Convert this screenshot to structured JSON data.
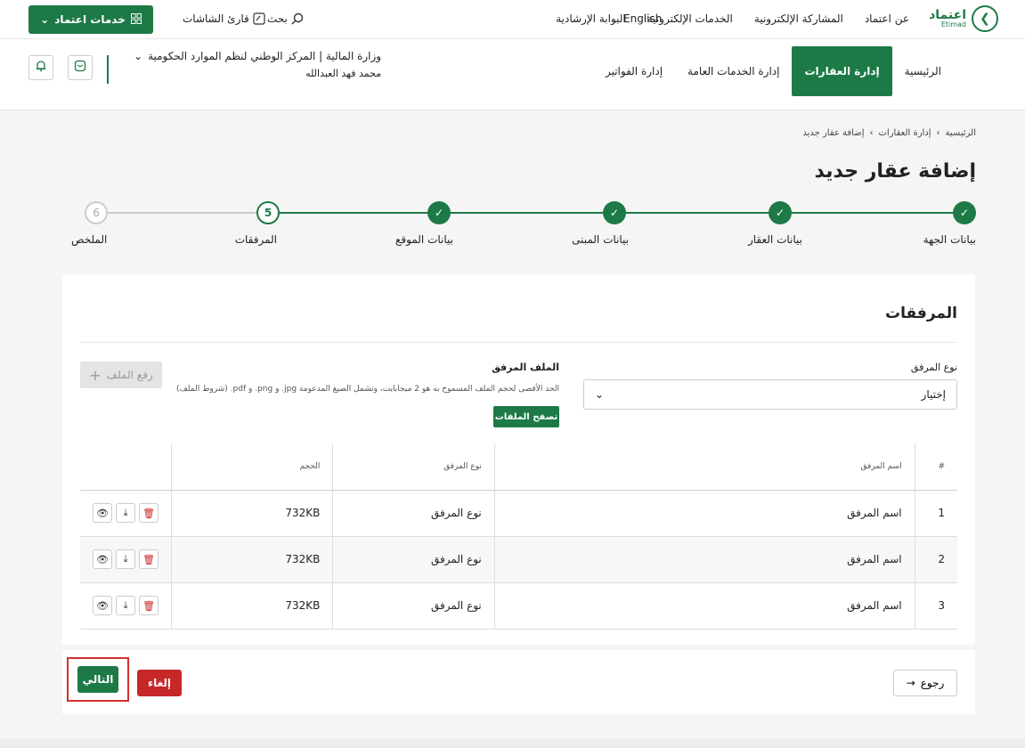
{
  "header": {
    "logo": {
      "ar": "اعتماد",
      "en": "Etimad"
    },
    "links": [
      "عن اعتماد",
      "المشاركة الإلكترونية",
      "الخدمات الإلكترونية",
      "البوابة الإرشادية"
    ],
    "language": "English",
    "search_label": "بحث",
    "reader_label": "قارئ الشاشات",
    "services_button": "خدمات اعتماد"
  },
  "nav": {
    "tabs": [
      {
        "label": "الرئيسية",
        "active": false
      },
      {
        "label": "إدارة العقارات",
        "active": true
      },
      {
        "label": "إدارة الخدمات العامة",
        "active": false
      },
      {
        "label": "إدارة الفواتير",
        "active": false
      }
    ],
    "org_name": "وزارة المالية | المركز الوطني لنظم الموارد الحكومية",
    "user_name": "محمد فهد العبدالله"
  },
  "breadcrumb": [
    "الرئيسية",
    "إدارة العقارات",
    "إضافة عقار جديد"
  ],
  "page_title": "إضافة عقار جديد",
  "stepper": {
    "steps": [
      {
        "label": "بيانات الجهة",
        "state": "done",
        "number": "1"
      },
      {
        "label": "بيانات العقار",
        "state": "done",
        "number": "2"
      },
      {
        "label": "بيانات المبنى",
        "state": "done",
        "number": "3"
      },
      {
        "label": "بيانات الموقع",
        "state": "done",
        "number": "4"
      },
      {
        "label": "المرفقات",
        "state": "current",
        "number": "5"
      },
      {
        "label": "الملخص",
        "state": "future",
        "number": "6"
      }
    ]
  },
  "attachments": {
    "section_title": "المرفقات",
    "type_label": "نوع المرفق",
    "type_value": "إختيار",
    "file_label": "الملف المرفق",
    "file_hint": "الحد الأقصى لحجم الملف المسموح به هو 2 ميجابايت، وتشمل الصيغ المدعومة jpg. و png. و pdf. (شروط الملف)",
    "browse_button": "تصفح الملفات",
    "upload_button": "رفع الملف",
    "table": {
      "headers": [
        "#",
        "اسم المرفق",
        "نوع المرفق",
        "الحجم",
        ""
      ],
      "rows": [
        {
          "index": "1",
          "name": "اسم المرفق",
          "type": "نوع المرفق",
          "size": "732KB"
        },
        {
          "index": "2",
          "name": "اسم المرفق",
          "type": "نوع المرفق",
          "size": "732KB"
        },
        {
          "index": "3",
          "name": "اسم المرفق",
          "type": "نوع المرفق",
          "size": "732KB"
        }
      ]
    }
  },
  "footer": {
    "back_button": "رجوع",
    "cancel_button": "إلغاء",
    "next_button": "التالي"
  },
  "colors": {
    "brand": "#1d7a46",
    "danger": "#c62828",
    "highlight": "#d32f2f"
  },
  "icons": {
    "eye": "eye-icon",
    "download": "download-icon",
    "delete": "trash-icon",
    "bell": "bell-icon",
    "chat": "chat-icon",
    "search": "search-icon",
    "grid": "grid-icon"
  }
}
